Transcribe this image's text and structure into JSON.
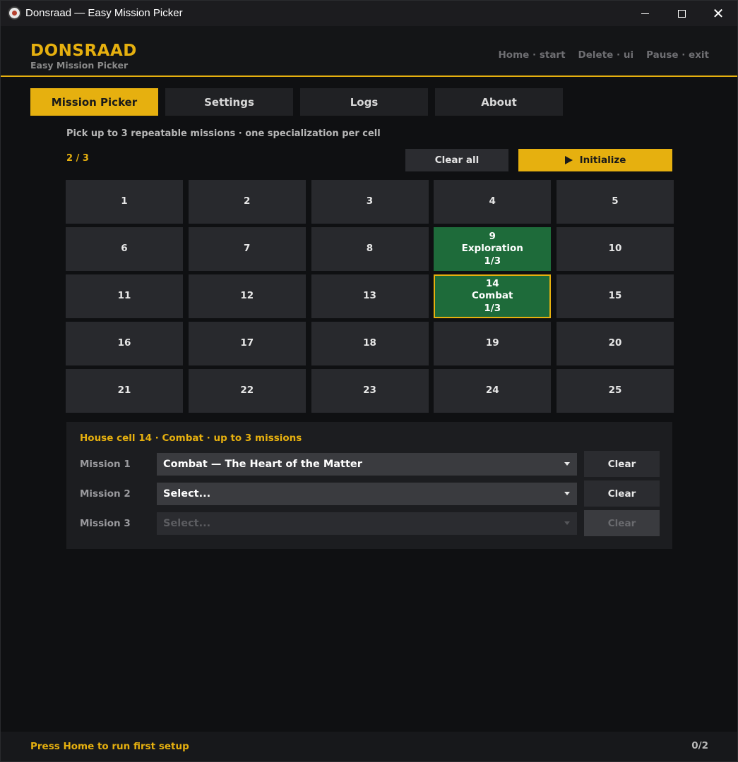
{
  "window": {
    "title": "Donsraad — Easy Mission Picker"
  },
  "header": {
    "brand": "DONSRAAD",
    "subtitle": "Easy Mission Picker",
    "hotkeys": [
      "Home · start",
      "Delete · ui",
      "Pause · exit"
    ]
  },
  "tabs": [
    {
      "label": "Mission Picker",
      "active": true
    },
    {
      "label": "Settings",
      "active": false
    },
    {
      "label": "Logs",
      "active": false
    },
    {
      "label": "About",
      "active": false
    }
  ],
  "picker": {
    "hint": "Pick up to 3 repeatable missions · one specialization per cell",
    "counter": "2 / 3",
    "clear_all_label": "Clear all",
    "initialize_label": "Initialize"
  },
  "grid": [
    {
      "num": "1"
    },
    {
      "num": "2"
    },
    {
      "num": "3"
    },
    {
      "num": "4"
    },
    {
      "num": "5"
    },
    {
      "num": "6"
    },
    {
      "num": "7"
    },
    {
      "num": "8"
    },
    {
      "num": "9",
      "spec": "Exploration",
      "count": "1/3",
      "assigned": true
    },
    {
      "num": "10"
    },
    {
      "num": "11"
    },
    {
      "num": "12"
    },
    {
      "num": "13"
    },
    {
      "num": "14",
      "spec": "Combat",
      "count": "1/3",
      "assigned": true,
      "selected": true
    },
    {
      "num": "15"
    },
    {
      "num": "16"
    },
    {
      "num": "17"
    },
    {
      "num": "18"
    },
    {
      "num": "19"
    },
    {
      "num": "20"
    },
    {
      "num": "21"
    },
    {
      "num": "22"
    },
    {
      "num": "23"
    },
    {
      "num": "24"
    },
    {
      "num": "25"
    }
  ],
  "panel": {
    "title": "House cell 14 · Combat · up to 3 missions",
    "rows": [
      {
        "label": "Mission 1",
        "value": "Combat — The Heart of the Matter",
        "clear_label": "Clear",
        "disabled": false
      },
      {
        "label": "Mission 2",
        "value": "Select...",
        "clear_label": "Clear",
        "disabled": false
      },
      {
        "label": "Mission 3",
        "value": "Select...",
        "clear_label": "Clear",
        "disabled": true
      }
    ]
  },
  "status": {
    "text": "Press Home to run first setup",
    "count": "0/2"
  },
  "colors": {
    "accent": "#e6b00f",
    "assigned": "#1e6b3a",
    "background": "#0f1012"
  }
}
